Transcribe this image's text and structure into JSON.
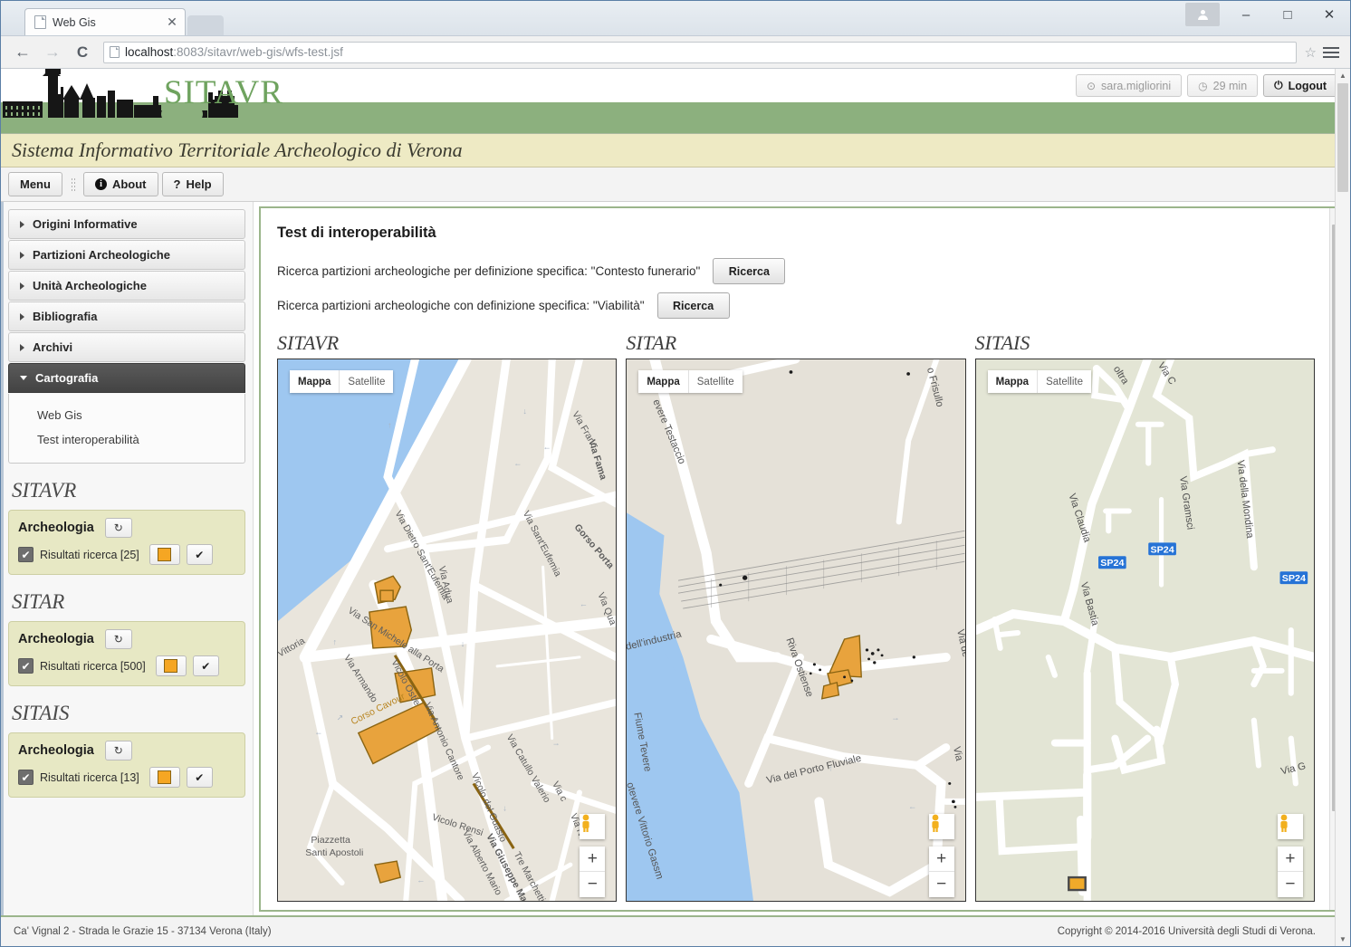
{
  "browser": {
    "tab_title": "Web Gis",
    "url_host": "localhost",
    "url_path": ":8083/sitavr/web-gis/wfs-test.jsf",
    "back_icon": "←",
    "forward_icon": "→",
    "reload_icon": "C",
    "star_icon": "☆",
    "minimize_icon": "–",
    "maximize_icon": "□",
    "close_icon": "✕",
    "tab_close_icon": "✕"
  },
  "header": {
    "logo_text": "SITAVR",
    "user_name": "sara.migliorini",
    "session_time": "29 min",
    "logout_label": "Logout",
    "user_icon": "⊙",
    "clock_icon": "◷",
    "power_icon": "⏻",
    "site_title": "Sistema Informativo Territoriale Archeologico di Verona",
    "brand_green": "#6fa35f",
    "band_cream": "#eeeac4"
  },
  "menubar": {
    "menu_label": "Menu",
    "about_label": "About",
    "about_icon": "i",
    "help_label": "Help",
    "help_icon": "?"
  },
  "sidebar": {
    "accordion": [
      {
        "label": "Origini Informative",
        "active": false
      },
      {
        "label": "Partizioni Archeologiche",
        "active": false
      },
      {
        "label": "Unità Archeologiche",
        "active": false
      },
      {
        "label": "Bibliografia",
        "active": false
      },
      {
        "label": "Archivi",
        "active": false
      },
      {
        "label": "Cartografia",
        "active": true
      }
    ],
    "cartografia_links": [
      "Web Gis",
      "Test interoperabilità"
    ],
    "layer_groups": [
      {
        "title": "SITAVR",
        "layer_name": "Archeologia",
        "refresh_icon": "↻",
        "checked": true,
        "check_icon": "✔",
        "result_label": "Risultati ricerca [25]",
        "swatch_color": "#f5a623",
        "apply_icon": "✔"
      },
      {
        "title": "SITAR",
        "layer_name": "Archeologia",
        "refresh_icon": "↻",
        "checked": true,
        "check_icon": "✔",
        "result_label": "Risultati ricerca [500]",
        "swatch_color": "#f5a623",
        "apply_icon": "✔"
      },
      {
        "title": "SITAIS",
        "layer_name": "Archeologia",
        "refresh_icon": "↻",
        "checked": true,
        "check_icon": "✔",
        "result_label": "Risultati ricerca [13]",
        "swatch_color": "#f5a623",
        "apply_icon": "✔"
      }
    ]
  },
  "main": {
    "page_title": "Test di interoperabilità",
    "searches": [
      {
        "text": "Ricerca partizioni archeologiche per definizione specifica: \"Contesto funerario\"",
        "button": "Ricerca"
      },
      {
        "text": "Ricerca partizioni archeologiche con definizione specifica: \"Viabilità\"",
        "button": "Ricerca"
      }
    ],
    "maps": [
      {
        "title": "SITAVR",
        "maptype_mappa": "Mappa",
        "maptype_satellite": "Satellite",
        "zoom_in": "+",
        "zoom_out": "−",
        "labels": [
          "Via Dietro Sant'Eufemia",
          "Via San Michele alla Porta",
          "Via Adua",
          "Via Sant'Eufemia",
          "Via Francesco",
          "Via Fama",
          "Gorso Porta",
          "Via Armando Diaz",
          "Vicolo Ostie",
          "Corso Cavour",
          "Via Antonio Cantore",
          "Vicolo del Guasto",
          "Via Catullo Valerio",
          "Vicolo Rensi",
          "Piazzetta Santi Apostoli",
          "Via Alberto Mario",
          "Via Giuseppe Mazzini",
          "Tre Marchetti",
          "Via Qua",
          "Vittoria"
        ]
      },
      {
        "title": "SITAR",
        "maptype_mappa": "Mappa",
        "maptype_satellite": "Satellite",
        "zoom_in": "+",
        "zoom_out": "−",
        "labels": [
          "Fiume Tevere",
          "Via del Porto Fluviale",
          "Riva Ostiense",
          "Lungotevere Testaccio",
          "Via Rocco Frisullo",
          "dell'industria",
          "Lungotevere Vittorio Gassman"
        ]
      },
      {
        "title": "SITAIS",
        "maptype_mappa": "Mappa",
        "maptype_satellite": "Satellite",
        "zoom_in": "+",
        "zoom_out": "−",
        "labels": [
          "Via Claudia",
          "Via Bastia",
          "Via Gramsci",
          "Via della Mondina",
          "oltra",
          "Via G",
          "SP24",
          "SP24",
          "SP24"
        ],
        "road_shield_color": "#2673d6"
      }
    ]
  },
  "footer": {
    "address": "Ca' Vignal 2 - Strada le Grazie 15 - 37134 Verona (Italy)",
    "copyright": "Copyright © 2014-2016 Università degli Studi di Verona."
  }
}
